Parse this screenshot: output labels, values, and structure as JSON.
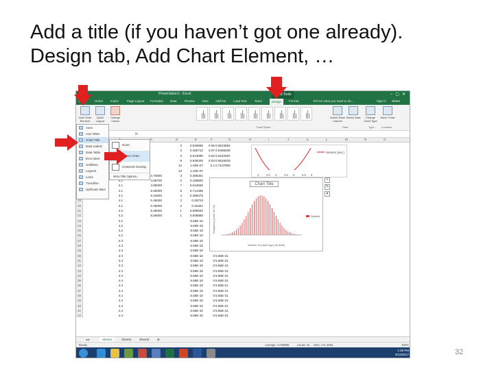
{
  "slide": {
    "title_line1": "Add a title (if you haven’t got one already).",
    "title_line2": "Design tab, Add Chart Element, …",
    "page_number": "32"
  },
  "excel": {
    "window_title": "Presentation1 - Excel",
    "chart_tools_label": "Chart Tools",
    "ribbon_tabs": [
      "File",
      "Home",
      "Insert",
      "Page Layout",
      "Formulas",
      "Data",
      "Review",
      "View",
      "Add-ins",
      "Load Test",
      "Team",
      "Design",
      "Format"
    ],
    "active_tab": "Design",
    "tell_me": "Tell me what you want to do...",
    "sign_in": "Sign in",
    "share": "Share",
    "ribbon_buttons": {
      "add_chart_element": "Add Chart Element",
      "quick_layout": "Quick Layout",
      "change_colors": "Change Colors",
      "switch_row_column": "Switch Row/ Column",
      "select_data": "Select Data",
      "change_chart_type": "Change Chart Type",
      "move_chart": "Move Chart"
    },
    "ribbon_groups": {
      "chart_styles": "Chart Styles",
      "data": "Data",
      "type": "Type",
      "location": "Location"
    },
    "add_element_menu": [
      "Axes",
      "Axis Titles",
      "Chart Title",
      "Data Labels",
      "Data Table",
      "Error Bars",
      "Gridlines",
      "Legend",
      "Lines",
      "Trendline",
      "Up/Down Bars"
    ],
    "chart_title_submenu": [
      "None",
      "Above Chart",
      "Centered Overlay"
    ],
    "chart_title_more": "More Title Options...",
    "chart": {
      "title_placeholder": "Chart Title",
      "y_axis_title": "Frequency (scale 1E-10)",
      "x_axis_title": "Number of y-axis log (x-fit-level)",
      "legend_label": "Series1",
      "bg_legend_label": "Series1 (est.)",
      "bg_x_ticks": [
        "3",
        "3.5",
        "4",
        "4.5",
        "5",
        "5.5",
        "6"
      ],
      "series_color": "#d94040"
    },
    "rows": [
      {
        "n": "8",
        "a": "",
        "b": "",
        "c": "3",
        "d": "0.526580",
        "e": "0.06",
        "f": "0.6523552"
      },
      {
        "n": "9",
        "a": "",
        "b": "",
        "c": "2",
        "d": "0.480712",
        "e": "0.07",
        "f": "0.6458328"
      },
      {
        "n": "10",
        "a": "",
        "b": "",
        "c": "3",
        "d": "0.513090",
        "e": "0.02",
        "f": "0.6242367"
      },
      {
        "n": "11",
        "a": "",
        "b": "",
        "c": "9",
        "d": "0.548348",
        "e": "0.03",
        "f": "0.6534833"
      },
      {
        "n": "12",
        "a": "",
        "b": "",
        "c": "13",
        "d": "1.00E-07",
        "e": "0.1",
        "f": "0.7107900"
      },
      {
        "n": "13",
        "a": "",
        "b": "",
        "c": "13",
        "d": "1.02E-07",
        "e": "",
        "f": ""
      },
      {
        "n": "14",
        "a": "4.1",
        "b": "4.70000",
        "c": "3",
        "d": "0.396301",
        "e": "",
        "f": ""
      },
      {
        "n": "15",
        "a": "4.1",
        "b": "4.86700",
        "c": "3",
        "d": "0.438820",
        "e": "",
        "f": ""
      },
      {
        "n": "16",
        "a": "4.1",
        "b": "4.96000",
        "c": "7",
        "d": "0.613846",
        "e": "",
        "f": ""
      },
      {
        "n": "17",
        "a": "4.1",
        "b": "5.06000",
        "c": "8",
        "d": "0.714466",
        "e": "",
        "f": ""
      },
      {
        "n": "18",
        "a": "4.1",
        "b": "5.16000",
        "c": "4",
        "d": "0.388476",
        "e": "",
        "f": ""
      },
      {
        "n": "19",
        "a": "4.1",
        "b": "5.26000",
        "c": "3",
        "d": "0.29723",
        "e": "",
        "f": ""
      },
      {
        "n": "20",
        "a": "4.1",
        "b": "5.36000",
        "c": "2",
        "d": "0.15451",
        "e": "",
        "f": ""
      },
      {
        "n": "21",
        "a": "4.2",
        "b": "5.46000",
        "c": "1",
        "d": "0.096532",
        "e": "",
        "f": ""
      },
      {
        "n": "22",
        "a": "4.2",
        "b": "5.56000",
        "c": "1",
        "d": "0.008858",
        "e": "",
        "f": ""
      },
      {
        "n": "23",
        "a": "4.2",
        "b": "",
        "c": "",
        "d": "5.56E-10",
        "e": "",
        "f": ""
      },
      {
        "n": "24",
        "a": "4.2",
        "b": "",
        "c": "",
        "d": "5.56E-10",
        "e": "",
        "f": ""
      },
      {
        "n": "25",
        "a": "4.2",
        "b": "",
        "c": "",
        "d": "5.56E-10",
        "e": "",
        "f": ""
      },
      {
        "n": "26",
        "a": "4.2",
        "b": "",
        "c": "",
        "d": "5.56E-10",
        "e": "",
        "f": ""
      },
      {
        "n": "27",
        "a": "4.3",
        "b": "",
        "c": "",
        "d": "5.56E-10",
        "e": "0",
        "f": "5.56E-31"
      },
      {
        "n": "28",
        "a": "4.3",
        "b": "",
        "c": "",
        "d": "5.56E-10",
        "e": "0",
        "f": "5.56E-31"
      },
      {
        "n": "29",
        "a": "4.3",
        "b": "",
        "c": "",
        "d": "5.56E-10",
        "e": "0",
        "f": "5.56E-31"
      },
      {
        "n": "30",
        "a": "4.3",
        "b": "",
        "c": "",
        "d": "5.56E-10",
        "e": "0",
        "f": "5.56E-31"
      },
      {
        "n": "31",
        "a": "4.3",
        "b": "",
        "c": "",
        "d": "5.56E-10",
        "e": "0",
        "f": "5.56E-31"
      },
      {
        "n": "32",
        "a": "4.3",
        "b": "",
        "c": "",
        "d": "5.56E-10",
        "e": "0",
        "f": "5.56E-31"
      },
      {
        "n": "33",
        "a": "4.3",
        "b": "",
        "c": "",
        "d": "5.56E-10",
        "e": "0",
        "f": "5.56E-31"
      },
      {
        "n": "34",
        "a": "4.3",
        "b": "",
        "c": "",
        "d": "5.56E-10",
        "e": "0",
        "f": "5.56E-31"
      },
      {
        "n": "35",
        "a": "4.4",
        "b": "",
        "c": "",
        "d": "5.56E-10",
        "e": "0",
        "f": "5.56E-31"
      },
      {
        "n": "36",
        "a": "4.4",
        "b": "",
        "c": "",
        "d": "5.56E-10",
        "e": "0",
        "f": "5.56E-31"
      },
      {
        "n": "37",
        "a": "4.4",
        "b": "",
        "c": "",
        "d": "5.56E-10",
        "e": "0",
        "f": "5.56E-31"
      },
      {
        "n": "38",
        "a": "4.4",
        "b": "",
        "c": "",
        "d": "5.56E-10",
        "e": "0",
        "f": "5.56E-31"
      },
      {
        "n": "39",
        "a": "4.4",
        "b": "",
        "c": "",
        "d": "5.56E-10",
        "e": "0",
        "f": "5.56E-31"
      },
      {
        "n": "40",
        "a": "4.4",
        "b": "",
        "c": "",
        "d": "5.56E-10",
        "e": "0",
        "f": "5.56E-31"
      },
      {
        "n": "41",
        "a": "4.4",
        "b": "",
        "c": "",
        "d": "5.56E-10",
        "e": "0",
        "f": "5.56E-31"
      },
      {
        "n": "42",
        "a": "4.4",
        "b": "",
        "c": "",
        "d": "5.56E-10",
        "e": "0",
        "f": "5.56E-31"
      }
    ],
    "col_headers": [
      "A",
      "B",
      "C",
      "D",
      "E",
      "F",
      "G",
      "H",
      "I",
      "J",
      "K",
      "L",
      "M",
      "N",
      "O"
    ],
    "sheet_tabs": [
      "Sheet1",
      "Sheet2",
      "Sheet3"
    ],
    "active_sheet": "Sheet1",
    "status": {
      "ready": "Ready",
      "average": "Average: 4.078695",
      "count": "Count: 42",
      "sum": "Sum: 171.3052",
      "zoom": "100%"
    },
    "clock": {
      "time": "1:35 PM",
      "date": "9/13/2017"
    }
  },
  "colors": {
    "excel_green": "#217346",
    "annotation_arrow": "#e02020",
    "taskbar": "#1c3f6e"
  }
}
